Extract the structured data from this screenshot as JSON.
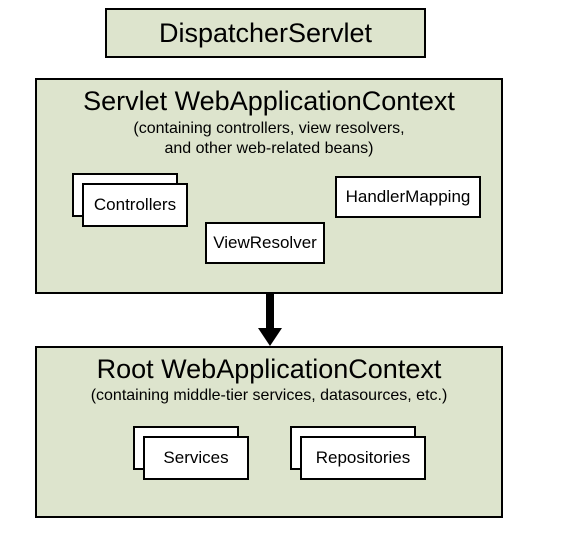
{
  "dispatcher": {
    "title": "DispatcherServlet"
  },
  "servletContext": {
    "title": "Servlet WebApplicationContext",
    "subtitle_line1": "(containing controllers, view resolvers,",
    "subtitle_line2": "and other web-related beans)",
    "boxes": {
      "controllers": "Controllers",
      "viewResolver": "ViewResolver",
      "handlerMapping": "HandlerMapping"
    }
  },
  "rootContext": {
    "title": "Root WebApplicationContext",
    "subtitle": "(containing middle-tier services, datasources, etc.)",
    "boxes": {
      "services": "Services",
      "repositories": "Repositories"
    }
  }
}
